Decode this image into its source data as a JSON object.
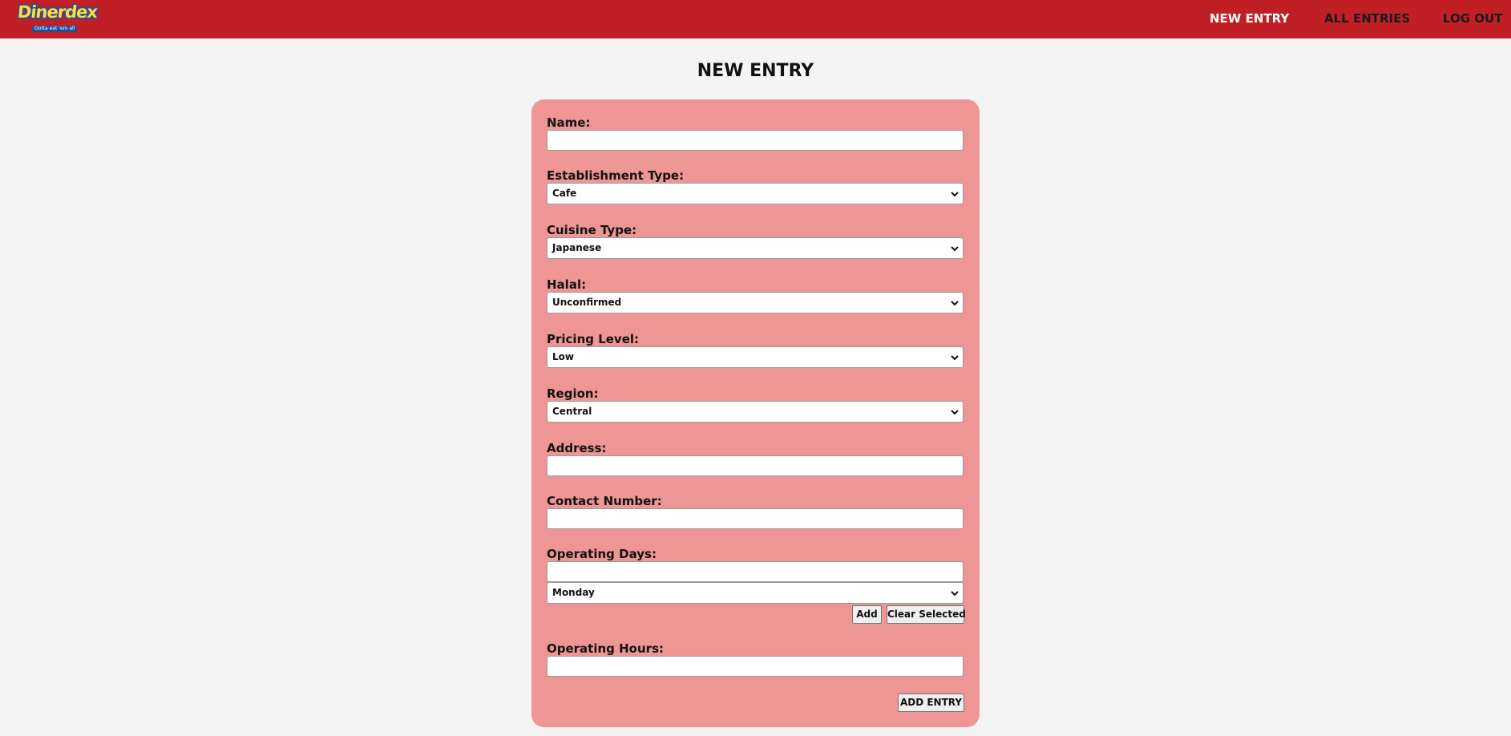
{
  "brand": {
    "logo_text": "Dinerdex",
    "logo_tagline": "Gotta eat 'em all",
    "colors": {
      "navbar": "#c11f26",
      "card": "#ee9695",
      "background": "#f4f4f4"
    }
  },
  "nav": {
    "new_entry": "NEW ENTRY",
    "all_entries": "ALL ENTRIES",
    "log_out": "LOG OUT"
  },
  "page_title": "NEW ENTRY",
  "form": {
    "name_label": "Name:",
    "name_value": "",
    "establishment_label": "Establishment Type:",
    "establishment_value": "Cafe",
    "cuisine_label": "Cuisine Type:",
    "cuisine_value": "Japanese",
    "halal_label": "Halal:",
    "halal_value": "Unconfirmed",
    "pricing_label": "Pricing Level:",
    "pricing_value": "Low",
    "region_label": "Region:",
    "region_value": "Central",
    "address_label": "Address:",
    "address_value": "",
    "contact_label": "Contact Number:",
    "contact_value": "",
    "days_label": "Operating Days:",
    "days_value": "",
    "day_select_value": "Monday",
    "add_button": "Add",
    "clear_button": "Clear Selected",
    "hours_label": "Operating Hours:",
    "hours_value": "",
    "submit_button": "ADD ENTRY"
  }
}
